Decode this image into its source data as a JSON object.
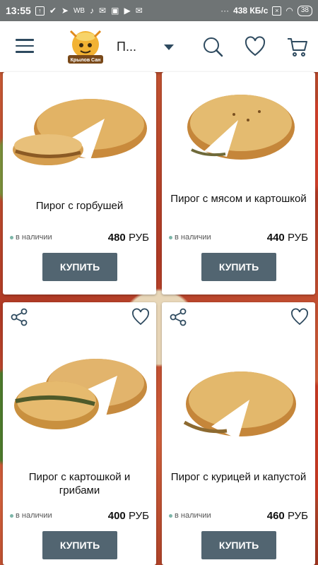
{
  "status_bar": {
    "time": "13:55",
    "icons": [
      "upload-icon",
      "check-icon",
      "send-icon",
      "wb-icon",
      "tiktok-icon",
      "mail-icon",
      "photo-icon",
      "play-icon",
      "mail-icon",
      "more-icon"
    ],
    "wb_label": "WB",
    "more": "···",
    "speed": "438 КБ/с",
    "battery": "38"
  },
  "header": {
    "title": "П...",
    "logo_text": "Крылов Сан"
  },
  "products": [
    {
      "name": "Пирог с горбушей",
      "stock": "в наличии",
      "price": "480",
      "currency": "РУБ",
      "buy": "КУПИТЬ"
    },
    {
      "name": "Пирог с мясом и картошкой",
      "stock": "в наличии",
      "price": "440",
      "currency": "РУБ",
      "buy": "КУПИТЬ"
    },
    {
      "name": "Пирог с картошкой и грибами",
      "stock": "в наличии",
      "price": "400",
      "currency": "РУБ",
      "buy": "КУПИТЬ"
    },
    {
      "name": "Пирог с курицей и капустой",
      "stock": "в наличии",
      "price": "460",
      "currency": "РУБ",
      "buy": "КУПИТЬ"
    }
  ],
  "colors": {
    "accent": "#526571",
    "stock_dot": "#7db6a8",
    "icon": "#2e4a5f"
  }
}
